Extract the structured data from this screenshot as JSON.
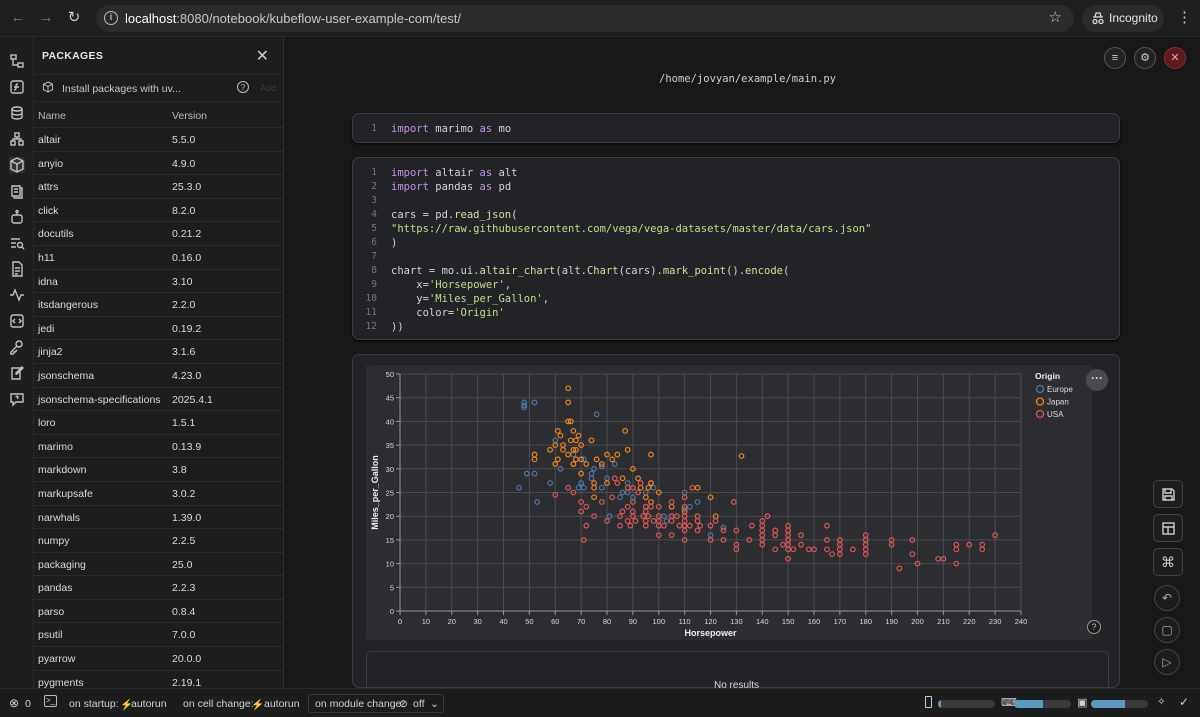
{
  "browser": {
    "url_host": "localhost",
    "url_rest": ":8080/notebook/kubeflow-user-example-com/test/",
    "incognito_label": "Incognito"
  },
  "packages": {
    "title": "PACKAGES",
    "install_placeholder": "Install packages with uv...",
    "add_label": "Add",
    "col_name": "Name",
    "col_version": "Version",
    "rows": [
      {
        "name": "altair",
        "version": "5.5.0"
      },
      {
        "name": "anyio",
        "version": "4.9.0"
      },
      {
        "name": "attrs",
        "version": "25.3.0"
      },
      {
        "name": "click",
        "version": "8.2.0"
      },
      {
        "name": "docutils",
        "version": "0.21.2"
      },
      {
        "name": "h11",
        "version": "0.16.0"
      },
      {
        "name": "idna",
        "version": "3.10"
      },
      {
        "name": "itsdangerous",
        "version": "2.2.0"
      },
      {
        "name": "jedi",
        "version": "0.19.2"
      },
      {
        "name": "jinja2",
        "version": "3.1.6"
      },
      {
        "name": "jsonschema",
        "version": "4.23.0"
      },
      {
        "name": "jsonschema-specifications",
        "version": "2025.4.1"
      },
      {
        "name": "loro",
        "version": "1.5.1"
      },
      {
        "name": "marimo",
        "version": "0.13.9"
      },
      {
        "name": "markdown",
        "version": "3.8"
      },
      {
        "name": "markupsafe",
        "version": "3.0.2"
      },
      {
        "name": "narwhals",
        "version": "1.39.0"
      },
      {
        "name": "numpy",
        "version": "2.2.5"
      },
      {
        "name": "packaging",
        "version": "25.0"
      },
      {
        "name": "pandas",
        "version": "2.2.3"
      },
      {
        "name": "parso",
        "version": "0.8.4"
      },
      {
        "name": "psutil",
        "version": "7.0.0"
      },
      {
        "name": "pyarrow",
        "version": "20.0.0"
      },
      {
        "name": "pygments",
        "version": "2.19.1"
      }
    ]
  },
  "notebook": {
    "file_path": "/home/jovyan/example/main.py",
    "no_results": "No results",
    "cell1": [
      {
        "ln": "1",
        "parts": [
          [
            "kw",
            "import"
          ],
          [
            "",
            "",
            " marimo "
          ],
          [
            "kw",
            "as"
          ],
          [
            "",
            " mo"
          ]
        ]
      }
    ],
    "cell2": [
      {
        "ln": "1",
        "parts": [
          [
            "kw",
            "import"
          ],
          [
            "",
            " altair "
          ],
          [
            "kw",
            "as"
          ],
          [
            "",
            " alt"
          ]
        ]
      },
      {
        "ln": "2",
        "parts": [
          [
            "kw",
            "import"
          ],
          [
            "",
            " pandas "
          ],
          [
            "kw",
            "as"
          ],
          [
            "",
            " pd"
          ]
        ]
      },
      {
        "ln": "3",
        "parts": []
      },
      {
        "ln": "4",
        "parts": [
          [
            "",
            "cars = pd."
          ],
          [
            "fn",
            "read_json"
          ],
          [
            "",
            "("
          ]
        ]
      },
      {
        "ln": "5",
        "parts": [
          [
            "st",
            "\"https://raw.githubusercontent.com/vega/vega-datasets/master/data/cars.json\""
          ]
        ]
      },
      {
        "ln": "6",
        "parts": [
          [
            "",
            ")"
          ]
        ]
      },
      {
        "ln": "7",
        "parts": []
      },
      {
        "ln": "8",
        "parts": [
          [
            "",
            "chart = mo.ui."
          ],
          [
            "fn",
            "altair_chart"
          ],
          [
            "",
            "(alt."
          ],
          [
            "fn",
            "Chart"
          ],
          [
            "",
            "(cars)."
          ],
          [
            "fn",
            "mark_point"
          ],
          [
            "",
            "()."
          ],
          [
            "fn",
            "encode"
          ],
          [
            "",
            "("
          ]
        ]
      },
      {
        "ln": "9",
        "parts": [
          [
            "",
            "    x="
          ],
          [
            "st",
            "'Horsepower'"
          ],
          [
            "",
            ","
          ]
        ]
      },
      {
        "ln": "10",
        "parts": [
          [
            "",
            "    y="
          ],
          [
            "st",
            "'Miles_per_Gallon'"
          ],
          [
            "",
            ","
          ]
        ]
      },
      {
        "ln": "11",
        "parts": [
          [
            "",
            "    color="
          ],
          [
            "st",
            "'Origin'"
          ]
        ]
      },
      {
        "ln": "12",
        "parts": [
          [
            "",
            "))"
          ]
        ]
      }
    ]
  },
  "status": {
    "errors": "0",
    "on_startup": "on startup:",
    "startup_val": "autorun",
    "on_cell_change": "on cell change:",
    "cell_change_val": "autorun",
    "on_module_change": "on module change:",
    "module_change_val": "off",
    "bar1": 0.05,
    "bar2": 0.5,
    "bar3": 0.6
  },
  "chart_data": {
    "type": "scatter",
    "xlabel": "Horsepower",
    "ylabel": "Miles_per_Gallon",
    "xlim": [
      0,
      240
    ],
    "ylim": [
      0,
      50
    ],
    "xticks": [
      0,
      10,
      20,
      30,
      40,
      50,
      60,
      70,
      80,
      90,
      100,
      110,
      120,
      130,
      140,
      150,
      160,
      170,
      180,
      190,
      200,
      210,
      220,
      230,
      240
    ],
    "yticks": [
      0,
      5,
      10,
      15,
      20,
      25,
      30,
      35,
      40,
      45,
      50
    ],
    "legend_title": "Origin",
    "grid": true,
    "series": [
      {
        "name": "Europe",
        "color": "#4c78a8",
        "points": [
          [
            46,
            26
          ],
          [
            48,
            43
          ],
          [
            48,
            44
          ],
          [
            48,
            43.4
          ],
          [
            49,
            29
          ],
          [
            52,
            44
          ],
          [
            52,
            29
          ],
          [
            53,
            23
          ],
          [
            58,
            27
          ],
          [
            60,
            36
          ],
          [
            62,
            30
          ],
          [
            67,
            31
          ],
          [
            67,
            33
          ],
          [
            69,
            26
          ],
          [
            70,
            27
          ],
          [
            71,
            26
          ],
          [
            71,
            32
          ],
          [
            74,
            29
          ],
          [
            74,
            28
          ],
          [
            75,
            30
          ],
          [
            76,
            41.5
          ],
          [
            78,
            30.5
          ],
          [
            78,
            26
          ],
          [
            80,
            28
          ],
          [
            81,
            20
          ],
          [
            83,
            31
          ],
          [
            85,
            24
          ],
          [
            86,
            25
          ],
          [
            88,
            27
          ],
          [
            88,
            25
          ],
          [
            90,
            26
          ],
          [
            90,
            24
          ],
          [
            95,
            25
          ],
          [
            95,
            22
          ],
          [
            97,
            27
          ],
          [
            98,
            26
          ],
          [
            102,
            20
          ],
          [
            103,
            19
          ],
          [
            105,
            20
          ],
          [
            110,
            21.5
          ],
          [
            110,
            25
          ],
          [
            112,
            22
          ],
          [
            115,
            23
          ],
          [
            120,
            16
          ],
          [
            125,
            17.6
          ]
        ]
      },
      {
        "name": "Japan",
        "color": "#f58518",
        "points": [
          [
            52,
            32
          ],
          [
            52,
            33
          ],
          [
            58,
            34
          ],
          [
            60,
            31
          ],
          [
            60,
            35
          ],
          [
            61,
            32
          ],
          [
            61,
            38
          ],
          [
            62,
            37
          ],
          [
            63,
            35
          ],
          [
            65,
            33
          ],
          [
            65,
            47
          ],
          [
            65,
            40
          ],
          [
            66,
            36
          ],
          [
            67,
            38
          ],
          [
            67,
            31
          ],
          [
            67,
            34
          ],
          [
            68,
            36
          ],
          [
            68,
            32
          ],
          [
            68,
            34
          ],
          [
            69,
            37
          ],
          [
            70,
            35
          ],
          [
            70,
            32
          ],
          [
            70,
            29
          ],
          [
            72,
            31
          ],
          [
            74,
            36
          ],
          [
            75,
            27
          ],
          [
            75,
            24
          ],
          [
            75,
            26
          ],
          [
            76,
            32
          ],
          [
            78,
            31
          ],
          [
            80,
            27
          ],
          [
            80,
            33
          ],
          [
            82,
            32
          ],
          [
            84,
            33
          ],
          [
            86,
            28
          ],
          [
            87,
            38
          ],
          [
            88,
            34
          ],
          [
            90,
            30
          ],
          [
            92,
            28
          ],
          [
            93,
            26
          ],
          [
            95,
            24
          ],
          [
            96,
            26
          ],
          [
            97,
            23
          ],
          [
            97,
            27
          ],
          [
            97,
            33
          ],
          [
            100,
            25
          ],
          [
            105,
            22
          ],
          [
            110,
            18
          ],
          [
            110,
            21
          ],
          [
            115,
            26
          ],
          [
            120,
            24
          ],
          [
            122,
            20
          ],
          [
            132,
            32.7
          ],
          [
            65,
            44
          ],
          [
            66,
            40
          ],
          [
            63,
            34
          ]
        ]
      },
      {
        "name": "USA",
        "color": "#e45756",
        "points": [
          [
            60,
            24.5
          ],
          [
            65,
            26
          ],
          [
            67,
            25
          ],
          [
            70,
            21
          ],
          [
            70,
            23
          ],
          [
            71,
            15
          ],
          [
            72,
            18
          ],
          [
            72,
            22
          ],
          [
            75,
            20
          ],
          [
            78,
            23
          ],
          [
            80,
            19
          ],
          [
            82,
            24
          ],
          [
            83,
            28
          ],
          [
            84,
            27
          ],
          [
            85,
            18
          ],
          [
            85,
            20
          ],
          [
            86,
            21
          ],
          [
            88,
            19
          ],
          [
            88,
            22
          ],
          [
            88,
            26
          ],
          [
            89,
            18
          ],
          [
            90,
            20
          ],
          [
            90,
            21
          ],
          [
            90,
            23
          ],
          [
            90,
            26
          ],
          [
            91,
            19
          ],
          [
            92,
            25
          ],
          [
            93,
            27
          ],
          [
            94,
            20
          ],
          [
            95,
            18
          ],
          [
            95,
            19
          ],
          [
            95,
            21
          ],
          [
            95,
            22
          ],
          [
            96,
            20
          ],
          [
            97,
            22
          ],
          [
            98,
            19
          ],
          [
            100,
            16
          ],
          [
            100,
            18
          ],
          [
            100,
            19
          ],
          [
            100,
            20
          ],
          [
            100,
            22
          ],
          [
            102,
            18
          ],
          [
            105,
            16
          ],
          [
            105,
            19
          ],
          [
            105,
            20
          ],
          [
            105,
            23
          ],
          [
            107,
            20
          ],
          [
            108,
            18
          ],
          [
            110,
            15
          ],
          [
            110,
            17
          ],
          [
            110,
            18
          ],
          [
            110,
            19
          ],
          [
            110,
            20
          ],
          [
            110,
            22
          ],
          [
            110,
            24
          ],
          [
            112,
            18
          ],
          [
            113,
            26
          ],
          [
            115,
            17
          ],
          [
            115,
            19
          ],
          [
            115,
            20
          ],
          [
            116,
            18
          ],
          [
            120,
            15
          ],
          [
            120,
            18
          ],
          [
            122,
            19
          ],
          [
            125,
            15
          ],
          [
            125,
            17
          ],
          [
            129,
            23
          ],
          [
            130,
            13
          ],
          [
            130,
            14
          ],
          [
            130,
            17
          ],
          [
            135,
            15
          ],
          [
            136,
            18
          ],
          [
            140,
            14
          ],
          [
            140,
            15
          ],
          [
            140,
            16
          ],
          [
            140,
            17
          ],
          [
            140,
            18
          ],
          [
            142,
            20
          ],
          [
            145,
            13
          ],
          [
            145,
            16
          ],
          [
            145,
            17
          ],
          [
            148,
            14
          ],
          [
            150,
            11
          ],
          [
            150,
            13
          ],
          [
            150,
            14
          ],
          [
            150,
            15
          ],
          [
            150,
            16
          ],
          [
            150,
            17
          ],
          [
            152,
            13
          ],
          [
            155,
            14
          ],
          [
            155,
            16
          ],
          [
            158,
            13
          ],
          [
            160,
            13
          ],
          [
            165,
            13
          ],
          [
            165,
            15
          ],
          [
            167,
            12
          ],
          [
            170,
            12
          ],
          [
            170,
            13
          ],
          [
            170,
            14
          ],
          [
            170,
            15
          ],
          [
            175,
            13
          ],
          [
            180,
            12
          ],
          [
            180,
            13
          ],
          [
            180,
            14
          ],
          [
            180,
            15
          ],
          [
            180,
            16
          ],
          [
            190,
            14
          ],
          [
            190,
            15
          ],
          [
            193,
            9
          ],
          [
            198,
            12
          ],
          [
            198,
            15
          ],
          [
            200,
            10
          ],
          [
            208,
            11
          ],
          [
            210,
            11
          ],
          [
            215,
            10
          ],
          [
            215,
            13
          ],
          [
            215,
            14
          ],
          [
            220,
            14
          ],
          [
            225,
            13
          ],
          [
            225,
            14
          ],
          [
            230,
            16
          ],
          [
            140,
            19
          ],
          [
            165,
            18
          ],
          [
            150,
            18
          ]
        ]
      }
    ]
  }
}
